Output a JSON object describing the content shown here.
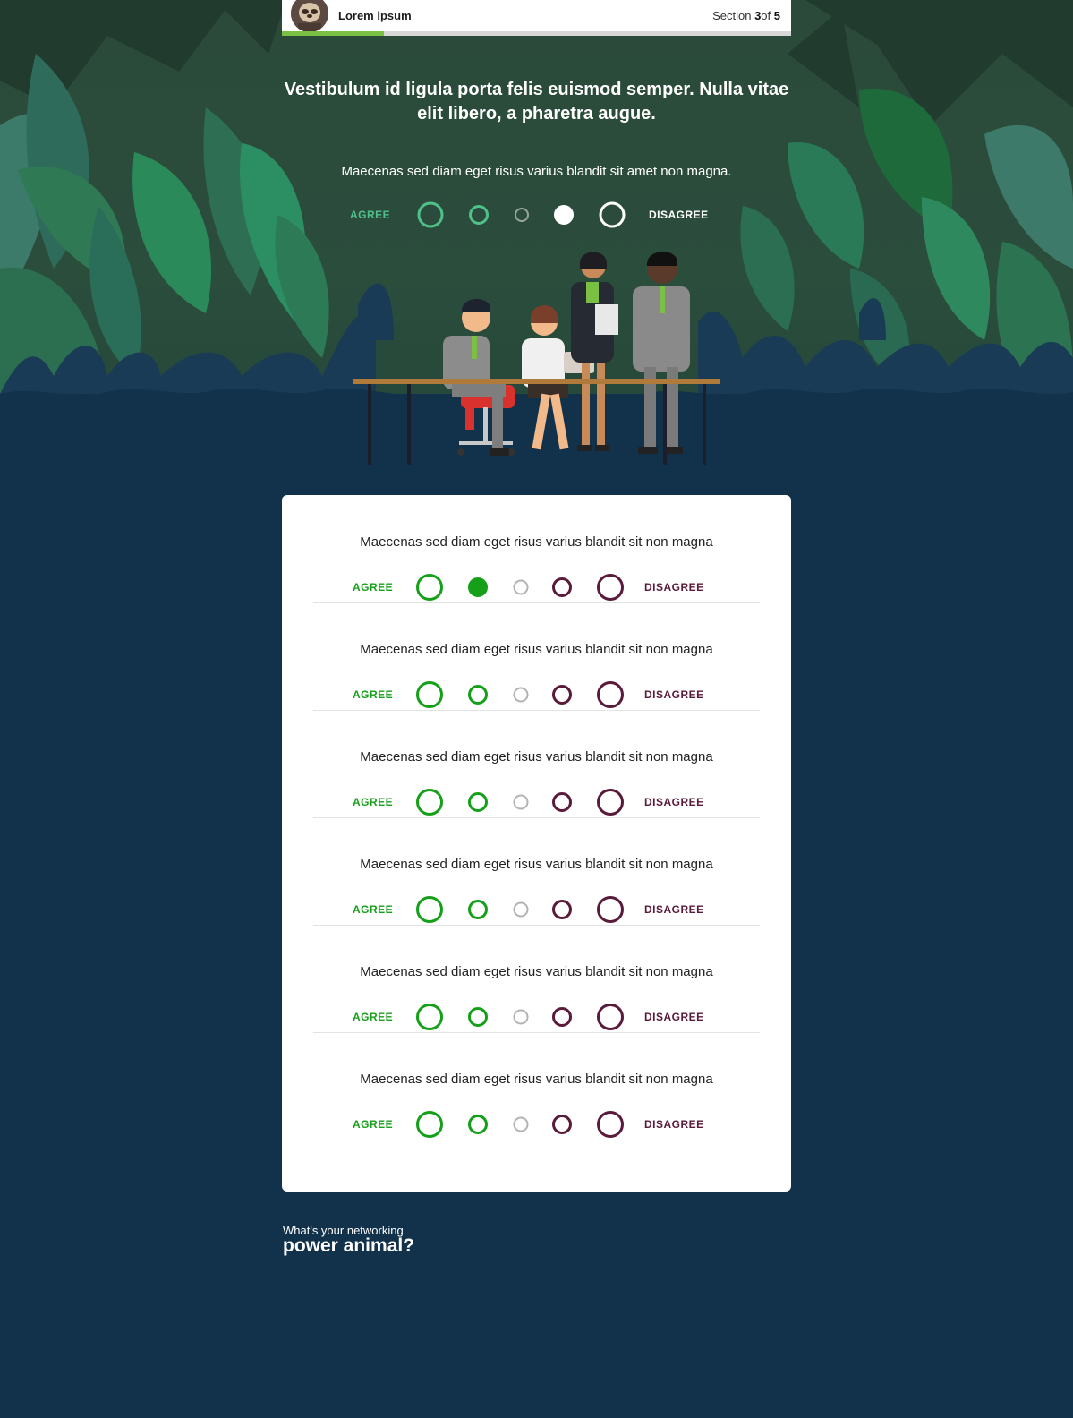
{
  "header": {
    "brand": "Lorem ipsum",
    "section_prefix": "Section",
    "section_current": "3",
    "section_of": "of",
    "section_total": "5",
    "progress_fraction": 0.2
  },
  "hero": {
    "heading": "Vestibulum id ligula porta felis euismod semper. Nulla vitae elit libero, a pharetra augue.",
    "question": "Maecenas sed diam eget risus varius blandit sit amet non magna.",
    "agree_label": "AGREE",
    "disagree_label": "DISAGREE",
    "selected_index": 3
  },
  "questions": [
    {
      "text": "Maecenas sed diam eget risus varius blandit sit non magna",
      "agree_label": "AGREE",
      "disagree_label": "DISAGREE",
      "selected_index": 1
    },
    {
      "text": "Maecenas sed diam eget risus varius blandit sit non magna",
      "agree_label": "AGREE",
      "disagree_label": "DISAGREE",
      "selected_index": null
    },
    {
      "text": "Maecenas sed diam eget risus varius blandit sit non magna",
      "agree_label": "AGREE",
      "disagree_label": "DISAGREE",
      "selected_index": null
    },
    {
      "text": "Maecenas sed diam eget risus varius blandit sit non magna",
      "agree_label": "AGREE",
      "disagree_label": "DISAGREE",
      "selected_index": null
    },
    {
      "text": "Maecenas sed diam eget risus varius blandit sit non magna",
      "agree_label": "AGREE",
      "disagree_label": "DISAGREE",
      "selected_index": null
    },
    {
      "text": "Maecenas sed diam eget risus varius blandit sit non magna",
      "agree_label": "AGREE",
      "disagree_label": "DISAGREE",
      "selected_index": null
    }
  ],
  "footer": {
    "tagline_small": "What's your networking",
    "tagline_big": "power animal?"
  },
  "colors": {
    "background": "#12314a",
    "agree": "#16a01a",
    "neutral": "#b3b3b3",
    "disagree": "#5a1a3a",
    "hero_agree": "#4fc08a",
    "progress": "#7ac143"
  },
  "icons": {
    "avatar": "sloth-avatar-icon",
    "illustration": "office-team-illustration"
  }
}
